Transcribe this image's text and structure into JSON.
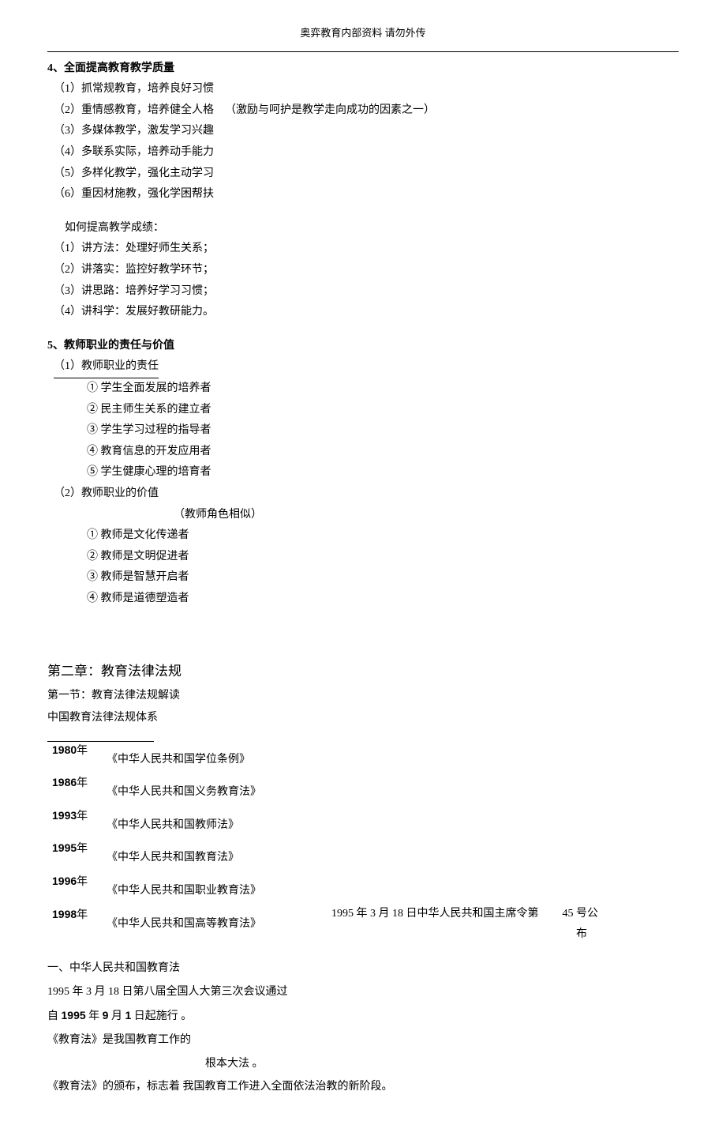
{
  "header_note": "奥弈教育内部资料  请勿外传",
  "s4": {
    "title": "4、全面提高教育教学质量",
    "i1": "（1）抓常规教育，培养良好习惯",
    "i2": "（2）重情感教育，培养健全人格",
    "i2_note": "（激励与呵护是教学走向成功的因素之一）",
    "i3": "（3）多媒体教学，激发学习兴趣",
    "i4": "（4）多联系实际，培养动手能力",
    "i5": "（5）多样化教学，强化主动学习",
    "i6": "（6）重因材施教，强化学困帮扶"
  },
  "improve": {
    "title": "如何提高教学成绩：",
    "i1": "（1）讲方法：处理好师生关系；",
    "i2": "（2）讲落实：监控好教学环节；",
    "i3": "（3）讲思路：培养好学习习惯；",
    "i4": "（4）讲科学：发展好教研能力。"
  },
  "s5": {
    "title": "5、教师职业的责任与价值",
    "resp_title": "（1）教师职业的责任",
    "r1": "①  学生全面发展的培养者",
    "r2": "②  民主师生关系的建立者",
    "r3": "③  学生学习过程的指导者",
    "r4": "④  教育信息的开发应用者",
    "r5": "⑤  学生健康心理的培育者",
    "val_title": "（2）教师职业的价值",
    "val_note": "（教师角色相似）",
    "v1": "①  教师是文化传递者",
    "v2": "②  教师是文明促进者",
    "v3": "③  教师是智慧开启者",
    "v4": "④  教师是道德塑造者"
  },
  "ch2": {
    "title": "第二章：教育法律法规",
    "sec1": "第一节：教育法律法规解读",
    "system": "中国教育法律法规体系"
  },
  "years": {
    "y1": "1980",
    "y1_suffix": "年",
    "l1": "《中华人民共和国学位条例》",
    "y2": "1986",
    "y2_suffix": "年",
    "l2": "《中华人民共和国义务教育法》",
    "y3": "1993",
    "y3_suffix": "年",
    "l3": "《中华人民共和国教师法》",
    "y4": "1995",
    "y4_suffix": "年",
    "l4": "《中华人民共和国教育法》",
    "y5": "1996",
    "y5_suffix": "年",
    "l5": "《中华人民共和国职业教育法》",
    "y6": "1998",
    "y6_suffix": "年",
    "l6": "《中华人民共和国高等教育法》"
  },
  "side": {
    "prefix": "1995 年 3 月 18 日中华人民共和国主席令第",
    "num": "45",
    "suffix1": "号公",
    "suffix2": "布"
  },
  "sec1": {
    "title": "一、中华人民共和国教育法",
    "l1a": "1995 年 3 月 18 日第八届全国人大第三次会议通过",
    "l2_pre": "自 ",
    "l2_date_a": "1995",
    "l2_mid1": " 年 ",
    "l2_date_b": "9",
    "l2_mid2": " 月 ",
    "l2_date_c": "1",
    "l2_post": " 日起施行 。",
    "l3a": "《教育法》是我国教育工作的",
    "l3b": "根本大法 。",
    "l4": "《教育法》的颁布，标志着 我国教育工作进入全面依法治教的新阶段。"
  }
}
